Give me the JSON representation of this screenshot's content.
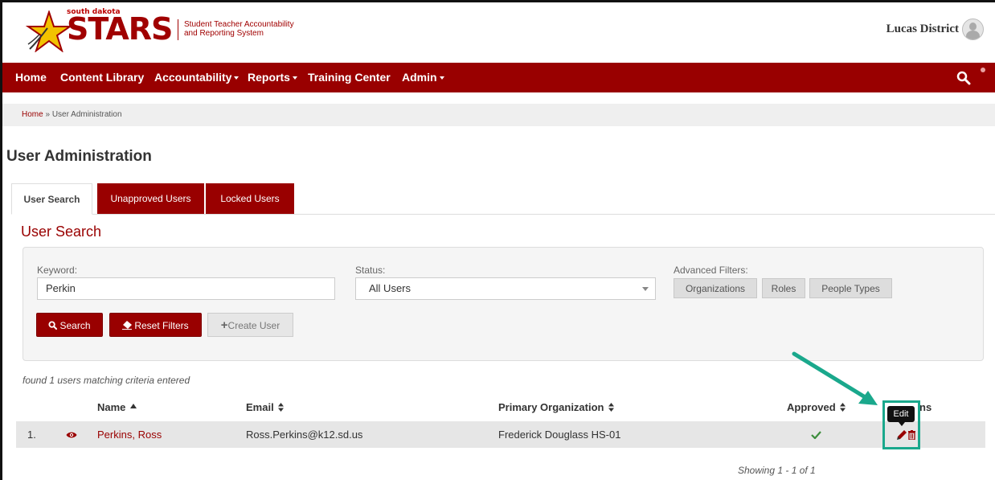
{
  "brand": {
    "small_text": "south dakota",
    "name": "STARS",
    "subtitle_line1": "Student Teacher Accountability",
    "subtitle_line2": "and Reporting System"
  },
  "user": {
    "name": "Lucas District"
  },
  "nav": {
    "items": [
      {
        "label": "Home"
      },
      {
        "label": "Content Library"
      },
      {
        "label": "Accountability"
      },
      {
        "label": "Reports"
      },
      {
        "label": "Training Center"
      },
      {
        "label": "Admin"
      }
    ]
  },
  "breadcrumb": {
    "home": "Home",
    "separator": " » ",
    "current": "User Administration"
  },
  "page_title": "User Administration",
  "tabs": [
    {
      "label": "User Search",
      "active": true
    },
    {
      "label": "Unapproved Users"
    },
    {
      "label": "Locked Users"
    }
  ],
  "search": {
    "title": "User Search",
    "keyword_label": "Keyword:",
    "keyword_value": "Perkin",
    "status_label": "Status:",
    "status_value": "All Users",
    "advanced_label": "Advanced Filters:",
    "filters": [
      "Organizations",
      "Roles",
      "People Types"
    ],
    "search_button": "Search",
    "reset_button": "Reset Filters",
    "create_button": "Create User"
  },
  "results": {
    "found_text": "found 1 users matching criteria entered",
    "columns": {
      "name": "Name",
      "email": "Email",
      "org": "Primary Organization",
      "approved": "Approved",
      "actions_partial": "ns"
    },
    "rows": [
      {
        "index": "1.",
        "name": "Perkins, Ross",
        "email": "Ross.Perkins@k12.sd.us",
        "org": "Frederick Douglass HS-01"
      }
    ],
    "showing": "Showing 1 - 1 of 1"
  },
  "tooltip": {
    "text": "Edit"
  },
  "colors": {
    "brand_red": "#990000",
    "highlight": "#1aa88c",
    "approved_green": "#3c8d3c"
  }
}
